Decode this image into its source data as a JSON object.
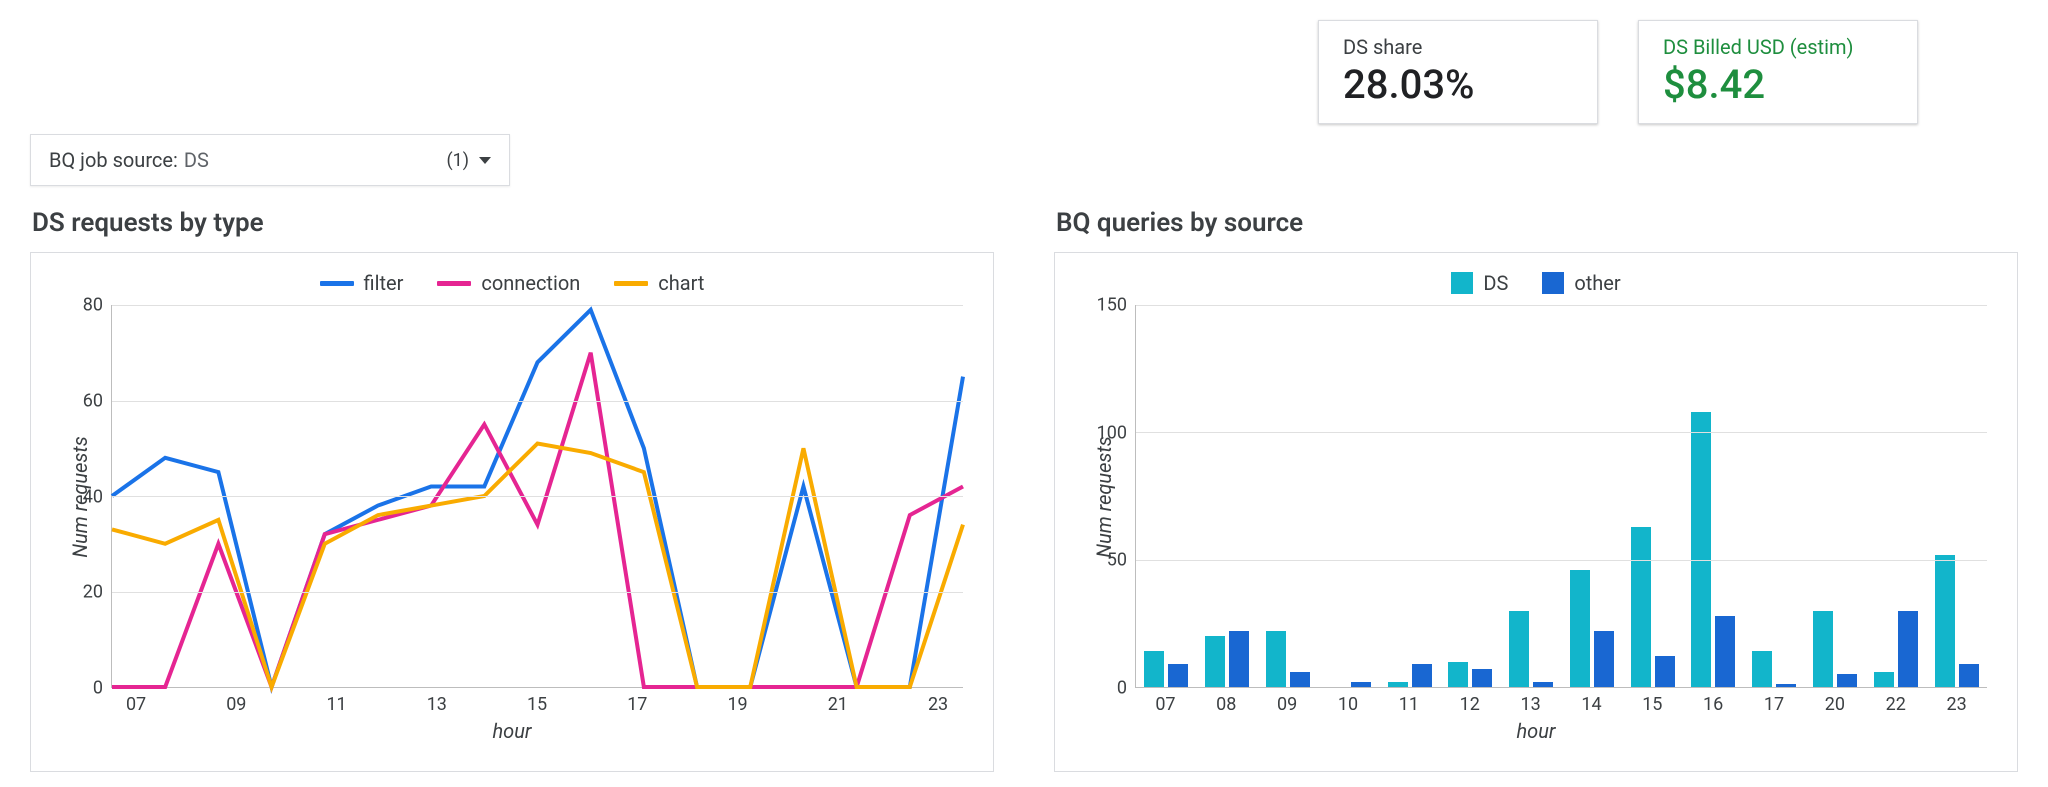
{
  "kpi": {
    "share": {
      "label": "DS share",
      "value": "28.03%"
    },
    "billed": {
      "label": "DS Billed USD (estim)",
      "value": "$8.42"
    }
  },
  "filter": {
    "label": "BQ job source:",
    "value": "DS",
    "count": "(1)"
  },
  "left": {
    "title": "DS requests by type",
    "ylabel": "Num requests",
    "xlabel": "hour",
    "legend": [
      "filter",
      "connection",
      "chart"
    ]
  },
  "right": {
    "title": "BQ queries by source",
    "ylabel": "Num requests",
    "xlabel": "hour",
    "legend": [
      "DS",
      "other"
    ]
  },
  "colors": {
    "filter": "#1a73e8",
    "connection": "#e52592",
    "chart": "#f9ab00",
    "ds": "#12b5cb",
    "other": "#1967d2"
  },
  "chart_data": [
    {
      "type": "line",
      "title": "DS requests by type",
      "xlabel": "hour",
      "ylabel": "Num requests",
      "ylim": [
        0,
        80
      ],
      "y_ticks": [
        0,
        20,
        40,
        60,
        80
      ],
      "x": [
        "07",
        "08",
        "09",
        "10",
        "11",
        "12",
        "13",
        "14",
        "15",
        "16",
        "17",
        "18",
        "19",
        "20",
        "21",
        "22",
        "23"
      ],
      "x_ticks": [
        "07",
        "09",
        "11",
        "13",
        "15",
        "17",
        "19",
        "21",
        "23"
      ],
      "series": [
        {
          "name": "filter",
          "values": [
            40,
            48,
            45,
            0,
            32,
            38,
            42,
            42,
            68,
            79,
            50,
            0,
            0,
            42,
            0,
            0,
            65
          ]
        },
        {
          "name": "connection",
          "values": [
            0,
            0,
            30,
            0,
            32,
            35,
            38,
            55,
            34,
            70,
            0,
            0,
            0,
            0,
            0,
            36,
            42
          ]
        },
        {
          "name": "chart",
          "values": [
            33,
            30,
            35,
            0,
            30,
            36,
            38,
            40,
            51,
            49,
            45,
            0,
            0,
            50,
            0,
            0,
            34
          ]
        }
      ]
    },
    {
      "type": "bar",
      "title": "BQ queries by source",
      "xlabel": "hour",
      "ylabel": "Num requests",
      "ylim": [
        0,
        150
      ],
      "y_ticks": [
        0,
        50,
        100,
        150
      ],
      "categories": [
        "07",
        "08",
        "09",
        "10",
        "11",
        "12",
        "13",
        "14",
        "15",
        "16",
        "17",
        "20",
        "22",
        "23"
      ],
      "series": [
        {
          "name": "DS",
          "values": [
            14,
            20,
            22,
            0,
            2,
            10,
            30,
            46,
            63,
            108,
            14,
            30,
            6,
            52
          ]
        },
        {
          "name": "other",
          "values": [
            9,
            22,
            6,
            2,
            9,
            7,
            2,
            22,
            12,
            28,
            1,
            5,
            30,
            9
          ]
        }
      ]
    }
  ]
}
